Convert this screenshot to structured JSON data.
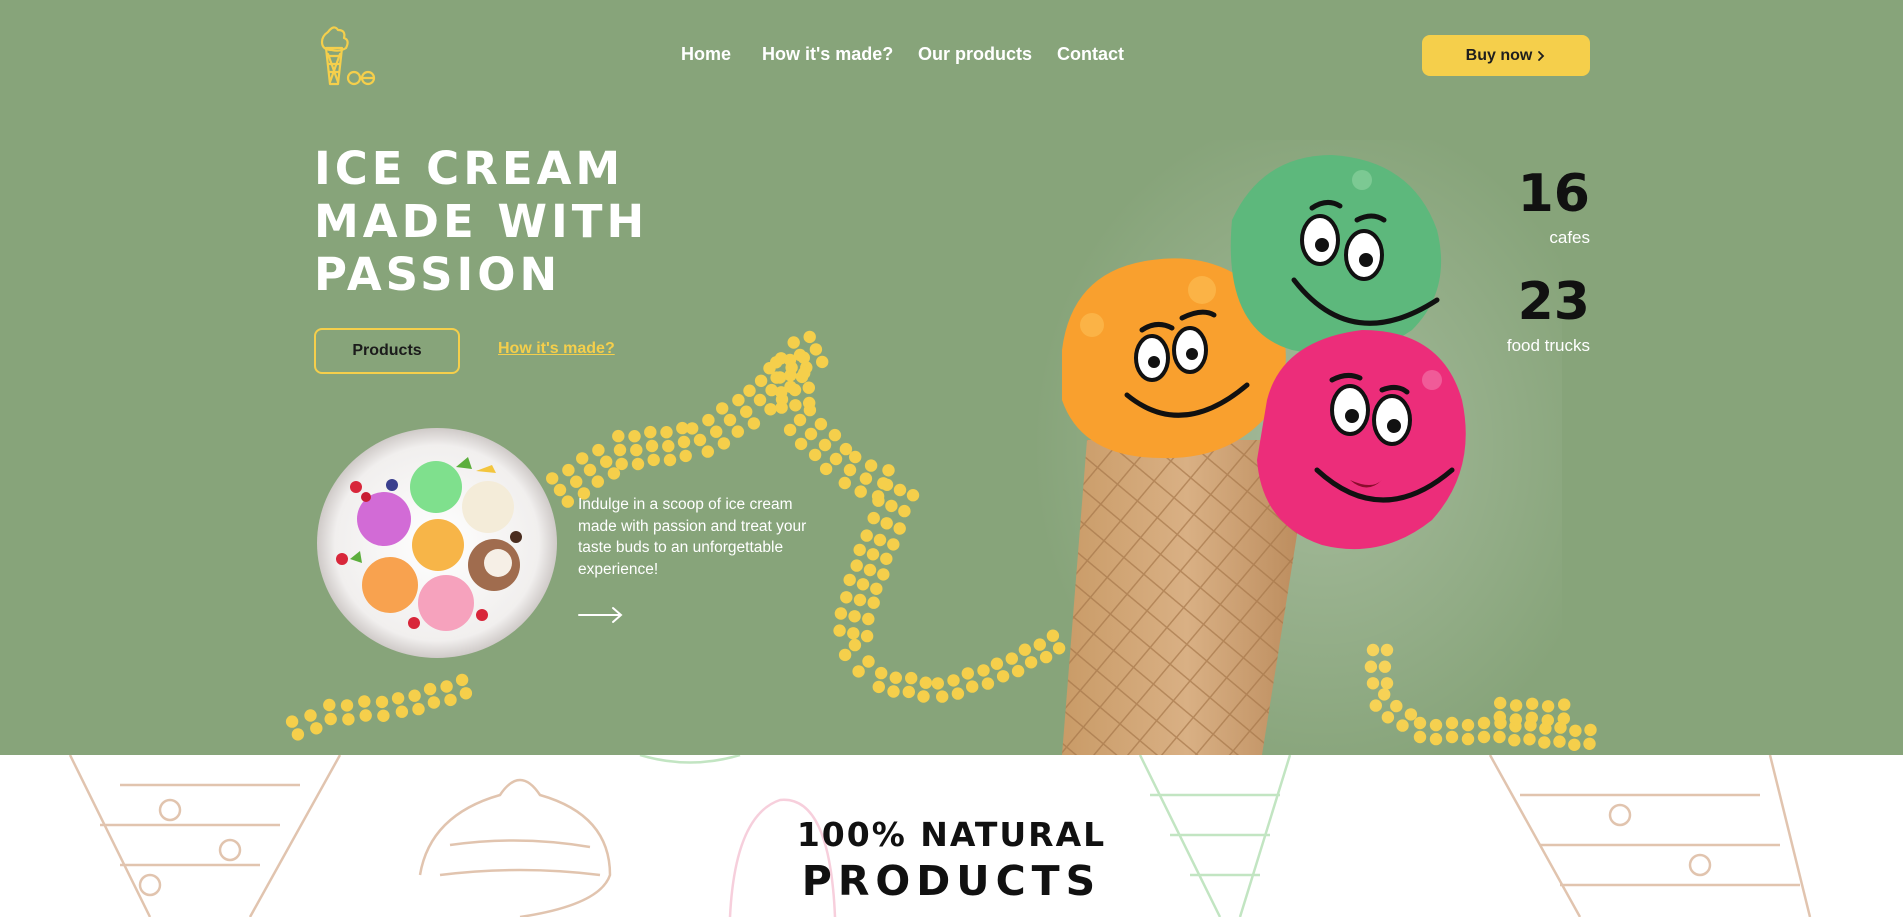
{
  "header": {
    "logo_alt": "ice cream logo",
    "nav": [
      {
        "label": "Home"
      },
      {
        "label": "How it's made?"
      },
      {
        "label": "Our products"
      },
      {
        "label": "Contact"
      }
    ],
    "buy_label": "Buy now",
    "buy_icon": "chevron-right-icon"
  },
  "hero": {
    "headline": [
      "ICE CREAM",
      "MADE WITH",
      "PASSION"
    ],
    "products_button": "Products",
    "how_link": "How it's made?",
    "intro": "Indulge in a scoop of ice cream made with passion and treat your taste buds to an unforgettable experience!",
    "arrow_icon": "arrow-right-icon"
  },
  "stats": [
    {
      "value": "16",
      "label": "cafes"
    },
    {
      "value": "23",
      "label": "food trucks"
    }
  ],
  "section": {
    "title_line1": "100% NATURAL",
    "title_line2": "PRODUCTS"
  },
  "colors": {
    "hero_bg": "#87a47a",
    "accent_yellow": "#f5cf4b",
    "text_white": "#ffffff",
    "text_dark": "#111111"
  }
}
